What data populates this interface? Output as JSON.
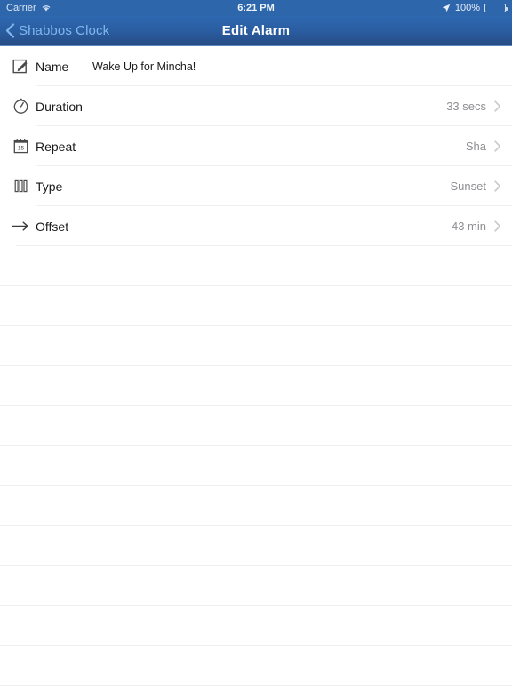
{
  "status_bar": {
    "carrier": "Carrier",
    "wifi_icon": "wifi-icon",
    "time": "6:21 PM",
    "location_icon": "location-arrow-icon",
    "battery_percent": "100%",
    "battery_icon": "battery-full-icon"
  },
  "nav_bar": {
    "back_icon": "chevron-left-icon",
    "back_label": "Shabbos Clock",
    "title": "Edit Alarm",
    "gradient_top": "#2f68b0",
    "gradient_bottom": "#264c84",
    "tint_color": "#7fb8ec"
  },
  "rows": [
    {
      "icon": "compose-icon",
      "label": "Name",
      "value": "Wake Up for Mincha!",
      "detail": "",
      "has_chevron": false
    },
    {
      "icon": "stopwatch-icon",
      "label": "Duration",
      "value": "",
      "detail": "33 secs",
      "has_chevron": true
    },
    {
      "icon": "calendar-icon",
      "label": "Repeat",
      "value": "",
      "detail": "Sha",
      "has_chevron": true
    },
    {
      "icon": "bars-icon",
      "label": "Type",
      "value": "",
      "detail": "Sunset",
      "has_chevron": true
    },
    {
      "icon": "arrow-right-icon",
      "label": "Offset",
      "value": "",
      "detail": "-43 min",
      "has_chevron": true
    }
  ],
  "calendar_icon_day": "15",
  "empty_row_count": 11,
  "colors": {
    "separator": "#f0f0f0",
    "detail_text": "#8e8e93",
    "primary_text": "#1a1a1a",
    "background": "#ffffff"
  }
}
